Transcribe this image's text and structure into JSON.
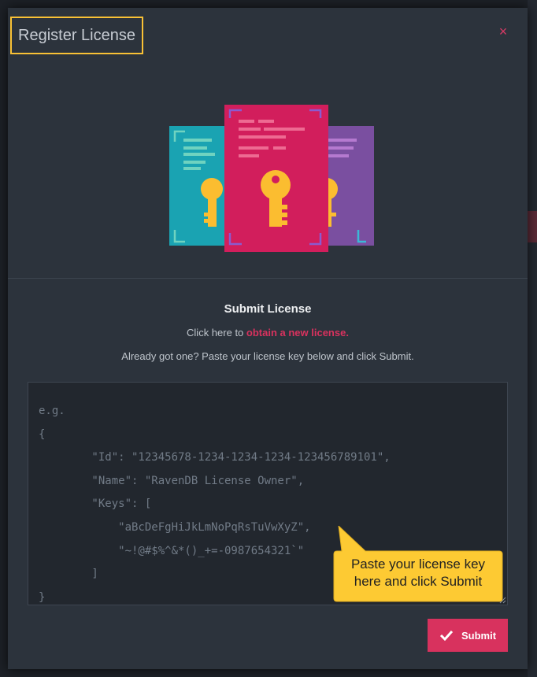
{
  "dialog": {
    "title": "Register License",
    "close_glyph": "×",
    "section_heading": "Submit License",
    "obtain_prefix": "Click here to",
    "obtain_link": "obtain a new license.",
    "paste_instruction": "Already got one? Paste your license key below and click Submit.",
    "textarea_placeholder": "e.g.\n{\n        \"Id\": \"12345678-1234-1234-1234-123456789101\",\n        \"Name\": \"RavenDB License Owner\",\n        \"Keys\": [\n            \"aBcDeFgHiJkLmNoPqRsTuVwXyZ\",\n            \"~!@#$%^&*()_+=-0987654321`\"\n        ]\n}",
    "callout_text": "Paste your license key here and click Submit",
    "submit_label": "Submit"
  },
  "icons": {
    "close": "close-icon",
    "submit": "check-icon",
    "illustration": "license-documents-key-icon"
  },
  "colors": {
    "accent": "#d8325e",
    "callout": "#fdca33",
    "highlight_border": "#f9c135",
    "doc_teal": "#1aa3b2",
    "doc_pink": "#d21e5c",
    "doc_purple": "#7a4fa0",
    "key": "#fbbd30"
  }
}
